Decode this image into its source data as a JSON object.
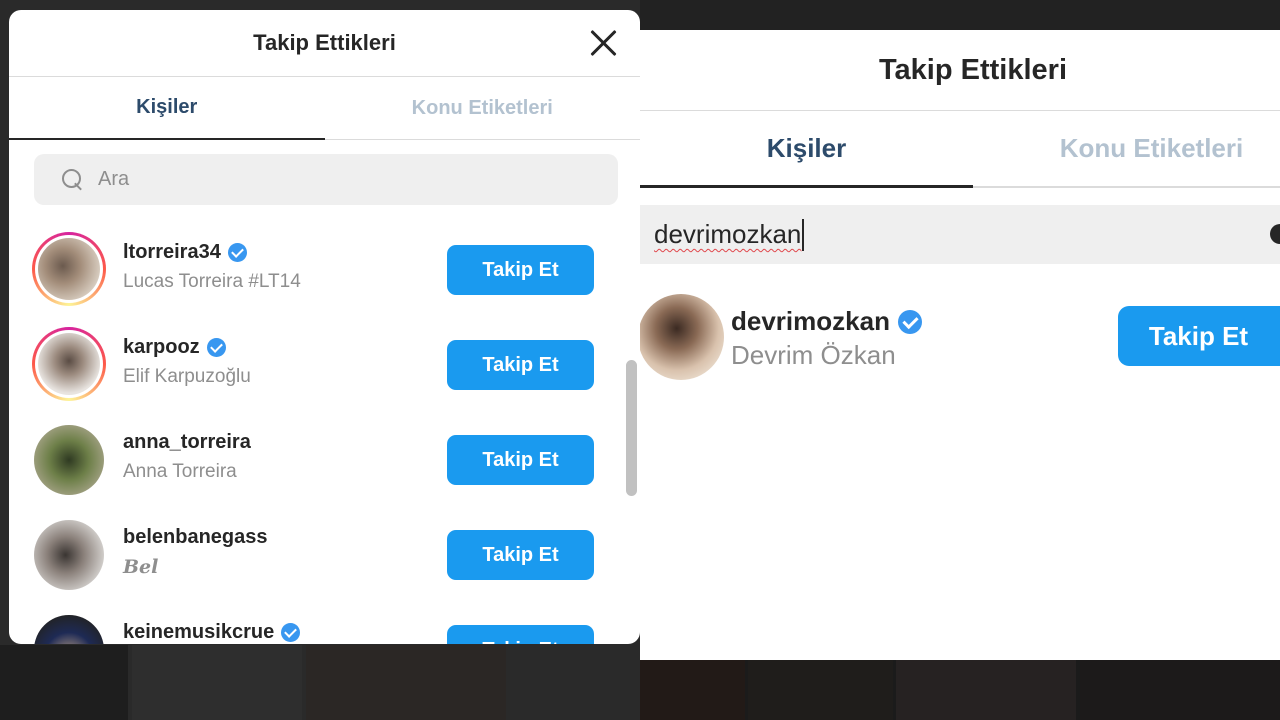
{
  "left_modal": {
    "title": "Takip Ettikleri",
    "tabs": [
      {
        "label": "Kişiler",
        "active": true
      },
      {
        "label": "Konu Etiketleri",
        "active": false
      }
    ],
    "search": {
      "placeholder": "Ara",
      "value": ""
    },
    "users": [
      {
        "username": "ltorreira34",
        "full_name": "Lucas Torreira #LT14",
        "verified": true,
        "story_ring": true,
        "button": "Takip Et"
      },
      {
        "username": "karpooz",
        "full_name": "Elif Karpuzoğlu",
        "verified": true,
        "story_ring": true,
        "button": "Takip Et"
      },
      {
        "username": "anna_torreira",
        "full_name": "Anna Torreira",
        "verified": false,
        "story_ring": false,
        "button": "Takip Et"
      },
      {
        "username": "belenbanegass",
        "full_name": "Bel",
        "verified": false,
        "story_ring": false,
        "button": "Takip Et"
      },
      {
        "username": "keinemusikcrue",
        "full_name": "",
        "verified": true,
        "story_ring": false,
        "button": "Takip Et"
      }
    ]
  },
  "right_modal": {
    "title": "Takip Ettikleri",
    "tabs": [
      {
        "label": "Kişiler",
        "active": true
      },
      {
        "label": "Konu Etiketleri",
        "active": false
      }
    ],
    "search": {
      "value": "devrimozkan"
    },
    "result": {
      "username": "devrimozkan",
      "full_name": "Devrim Özkan",
      "verified": true,
      "button": "Takip Et"
    }
  },
  "colors": {
    "accent_button": "#1a9aef",
    "verified_badge": "#3897f0",
    "active_tab_text": "#2d4b6b",
    "inactive_tab_text": "#b3c2d0"
  }
}
